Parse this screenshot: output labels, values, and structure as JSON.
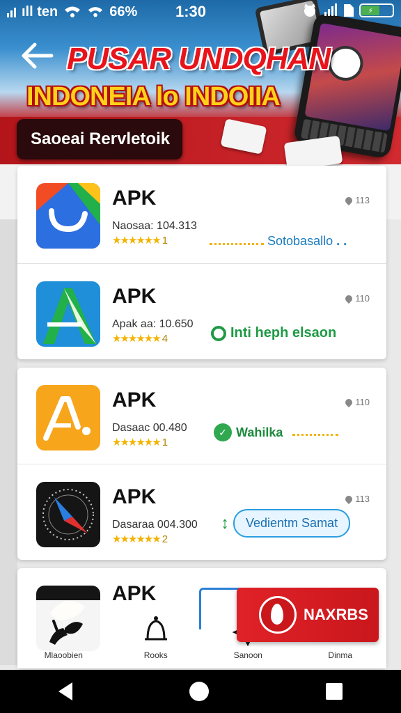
{
  "status_bar": {
    "carrier": "ıll ten",
    "battery_pct": "66%",
    "time": "1:30",
    "battery_label": "⚡"
  },
  "header": {
    "title_line1": "PUSAR UNDQHAN",
    "title_line2": "INDONEIA lo INDOIIA",
    "subtitle": "Saoeai Rervletoik"
  },
  "apps": [
    {
      "name": "APK",
      "meta": "Naosaa: 104.313",
      "rating": "1",
      "size": "113",
      "action": "Sotobasallo",
      "action_type": "link"
    },
    {
      "name": "APK",
      "meta": "Apak aa: 10.650",
      "rating": "4",
      "size": "110",
      "action": "Inti heph elsaon",
      "action_type": "install"
    },
    {
      "name": "APK",
      "meta": "Dasaac 00.480",
      "rating": "1",
      "size": "110",
      "action": "Wahilka",
      "action_type": "brand"
    },
    {
      "name": "APK",
      "meta": "Dasaraa 004.300",
      "rating": "2",
      "size": "113",
      "action": "Vedientm Samat",
      "action_type": "button"
    },
    {
      "name": "APK"
    }
  ],
  "bottom_nav": [
    {
      "label": "Mlaoobien",
      "icon": "hand-leaf-icon"
    },
    {
      "label": "Rooks",
      "icon": "bell-icon"
    },
    {
      "label": "Sanoon",
      "icon": "sparkle-icon"
    },
    {
      "label": "Dinma",
      "icon": "promo-icon"
    }
  ],
  "promo": {
    "label": "NAXRBS"
  },
  "colors": {
    "brand_red": "#e8141b",
    "title_yellow": "#ffd21a",
    "install_green": "#1e9a45",
    "link_blue": "#1a7bbf"
  }
}
